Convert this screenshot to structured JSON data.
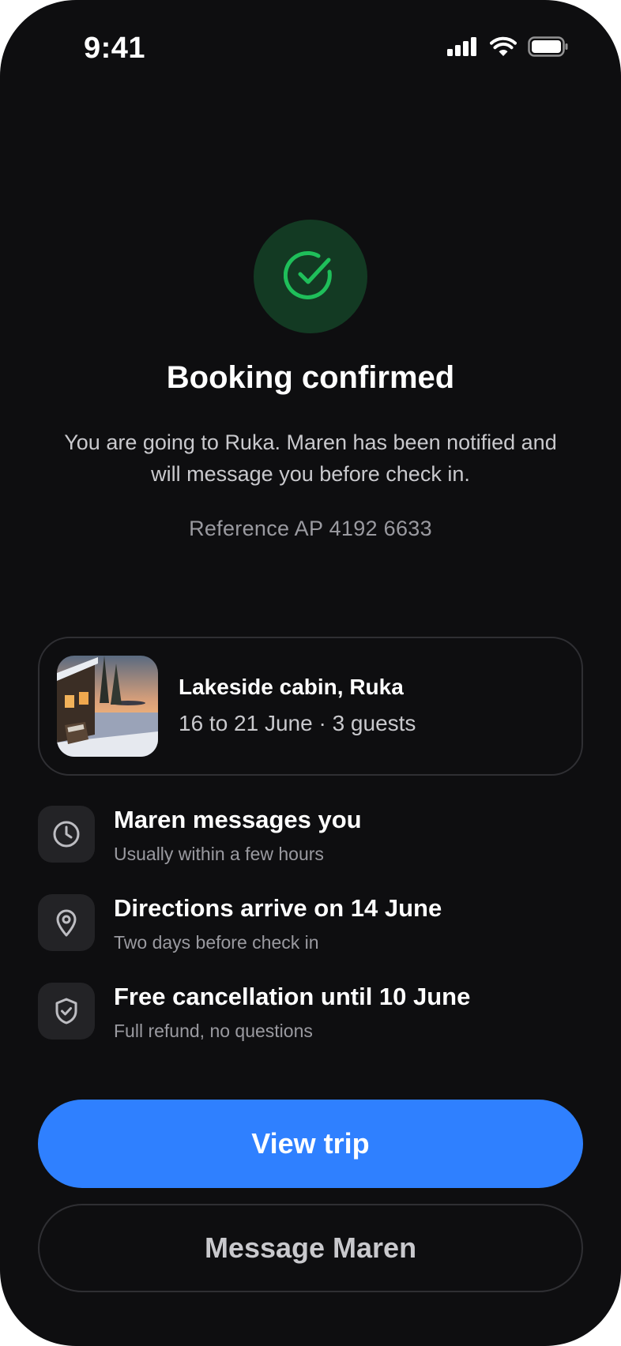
{
  "status_bar": {
    "time": "9:41",
    "icons": [
      "cellular-signal-icon",
      "wifi-icon",
      "battery-icon"
    ]
  },
  "hero": {
    "icon": "check-circle-icon",
    "title": "Booking confirmed",
    "message": "You are going to Ruka. Maren has been notified and will message you before check in.",
    "reference": "Reference AP 4192 6633"
  },
  "trip": {
    "name": "Lakeside cabin, Ruka",
    "details": "16 to 21 June · 3 guests",
    "thumbnail": "cabin-photo"
  },
  "info": [
    {
      "icon": "clock-icon",
      "title": "Maren messages you",
      "subtitle": "Usually within a few hours"
    },
    {
      "icon": "map-pin-icon",
      "title": "Directions arrive on 14 June",
      "subtitle": "Two days before check in"
    },
    {
      "icon": "shield-check-icon",
      "title": "Free cancellation until 10 June",
      "subtitle": "Full refund, no questions"
    }
  ],
  "actions": {
    "primary": "View trip",
    "secondary": "Message Maren"
  },
  "colors": {
    "background": "#0e0e10",
    "accent": "#2f80ff",
    "success": "#1fbf5a",
    "success_bg": "#133a23"
  }
}
